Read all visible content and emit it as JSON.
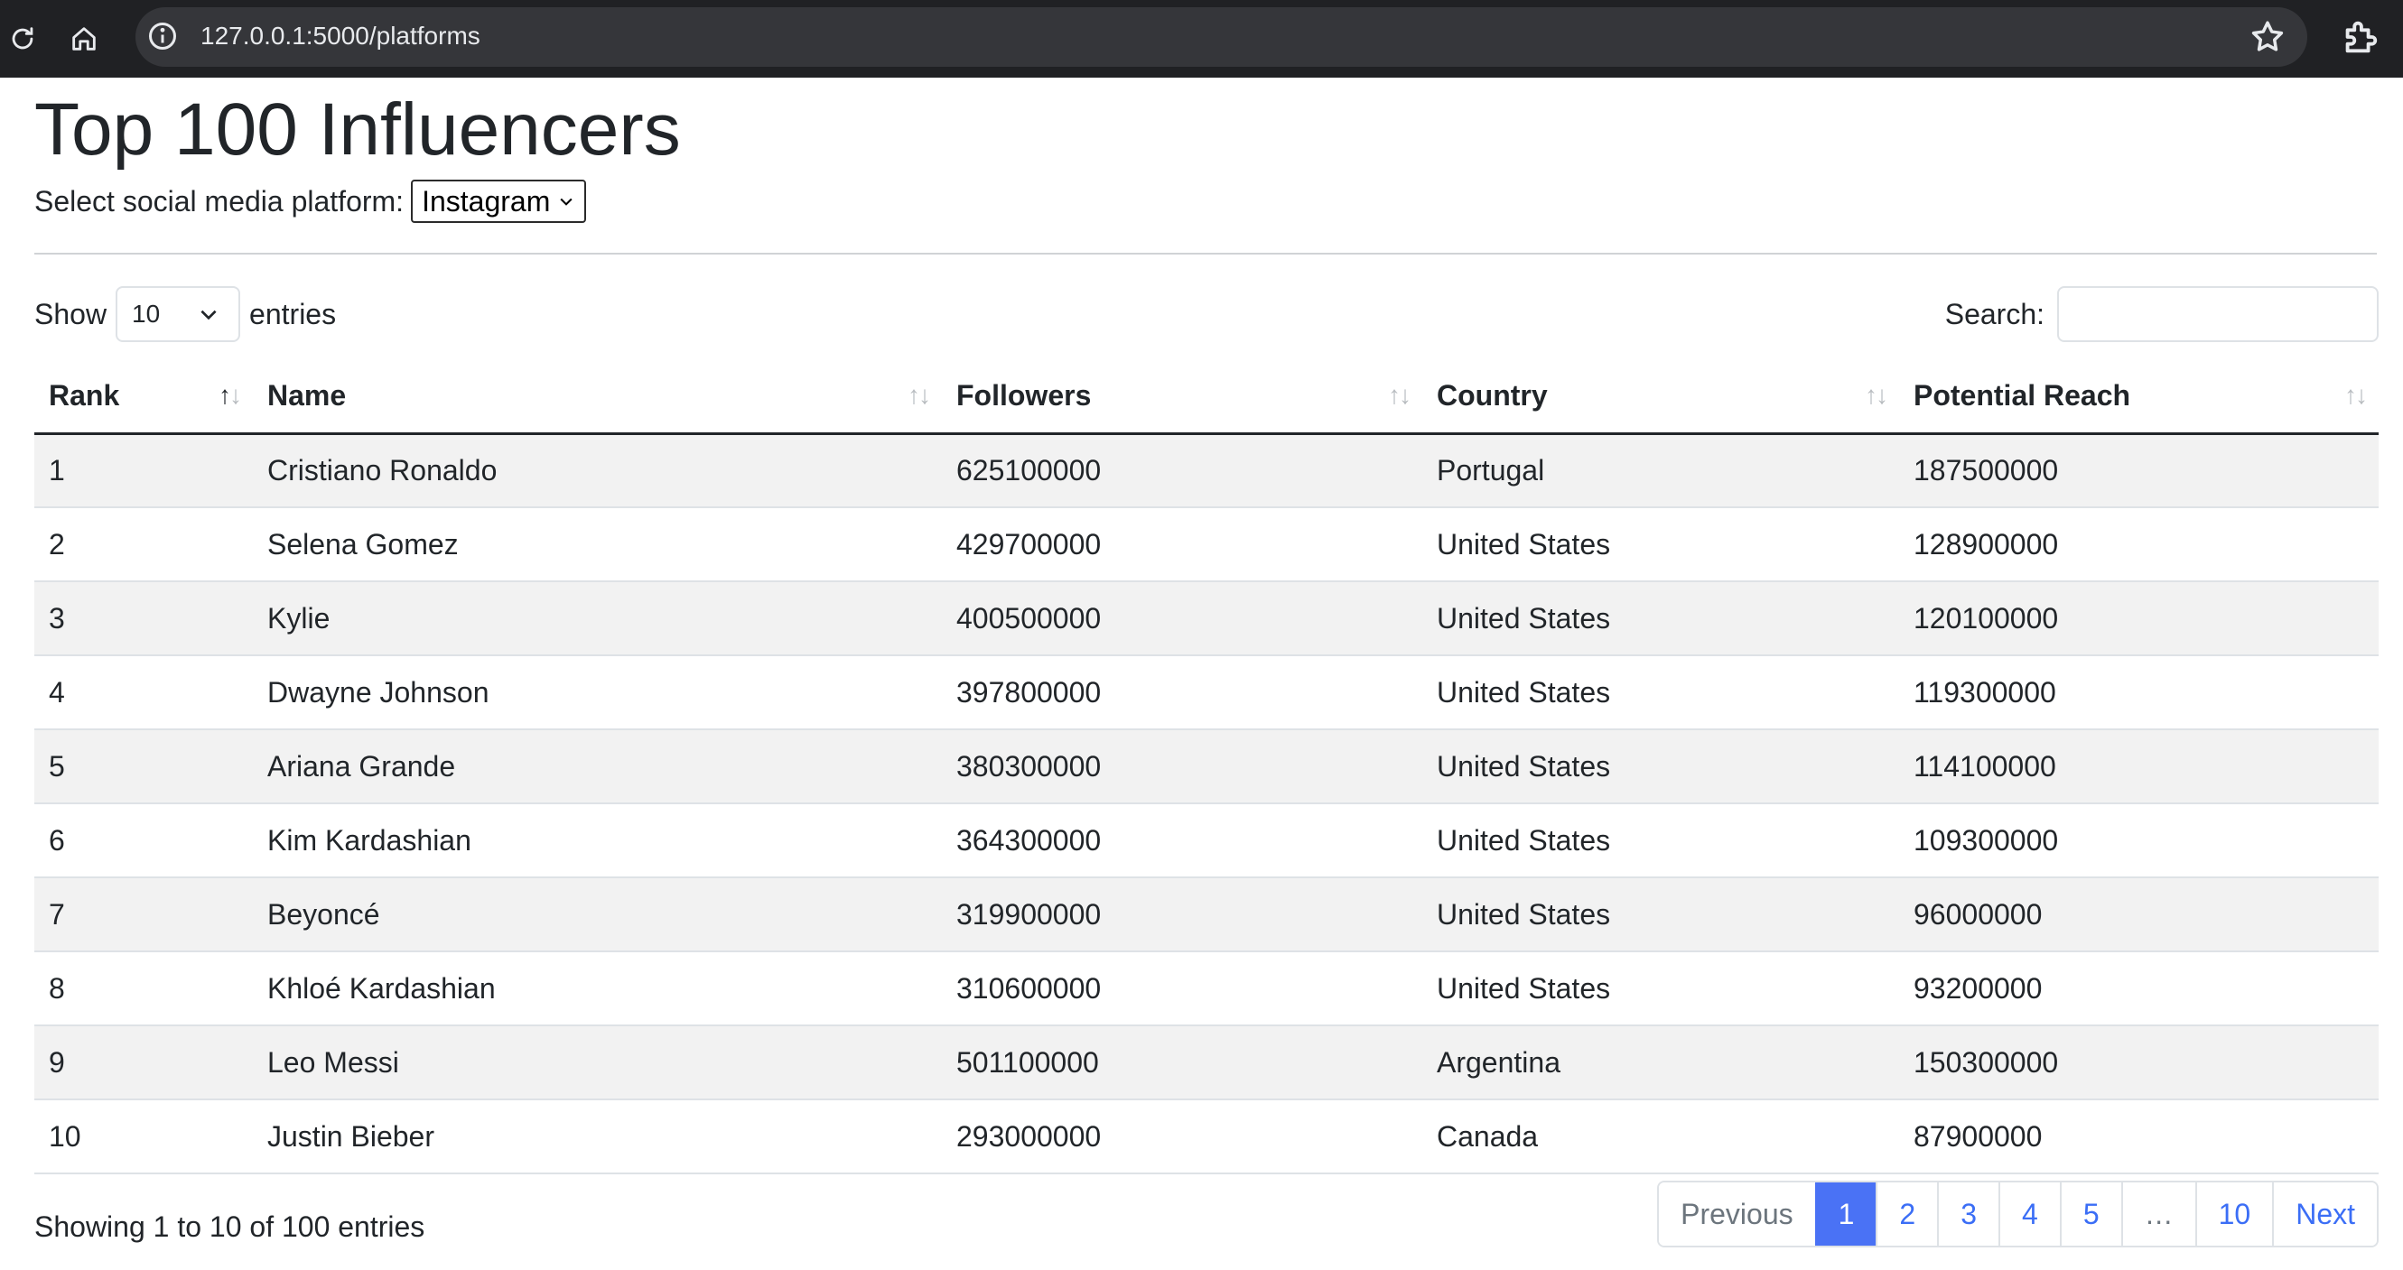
{
  "browser": {
    "url": "127.0.0.1:5000/platforms"
  },
  "page": {
    "title": "Top 100 Influencers",
    "platform_label": "Select social media platform:",
    "platform_selected": "Instagram"
  },
  "controls": {
    "show_label": "Show",
    "entries_value": "10",
    "entries_label": "entries",
    "search_label": "Search:",
    "search_value": "",
    "search_placeholder": ""
  },
  "table": {
    "columns": [
      "Rank",
      "Name",
      "Followers",
      "Country",
      "Potential Reach"
    ],
    "rows": [
      [
        "1",
        "Cristiano Ronaldo",
        "625100000",
        "Portugal",
        "187500000"
      ],
      [
        "2",
        "Selena Gomez",
        "429700000",
        "United States",
        "128900000"
      ],
      [
        "3",
        "Kylie",
        "400500000",
        "United States",
        "120100000"
      ],
      [
        "4",
        "Dwayne Johnson",
        "397800000",
        "United States",
        "119300000"
      ],
      [
        "5",
        "Ariana Grande",
        "380300000",
        "United States",
        "114100000"
      ],
      [
        "6",
        "Kim Kardashian",
        "364300000",
        "United States",
        "109300000"
      ],
      [
        "7",
        "Beyoncé",
        "319900000",
        "United States",
        "96000000"
      ],
      [
        "8",
        "Khloé Kardashian",
        "310600000",
        "United States",
        "93200000"
      ],
      [
        "9",
        "Leo Messi",
        "501100000",
        "Argentina",
        "150300000"
      ],
      [
        "10",
        "Justin Bieber",
        "293000000",
        "Canada",
        "87900000"
      ]
    ],
    "sorted_column": "Rank",
    "sort_direction": "ascending"
  },
  "footer": {
    "info": "Showing 1 to 10 of 100 entries",
    "pagination": {
      "previous": "Previous",
      "pages": [
        "1",
        "2",
        "3",
        "4",
        "5",
        "…",
        "10"
      ],
      "active_page": "1",
      "next": "Next"
    }
  },
  "colors": {
    "browser_bar": "#202124",
    "omnibox": "#35363a",
    "active_page": "#4a72f5",
    "link": "#3b6ef6",
    "striped_row": "#f2f2f2"
  }
}
